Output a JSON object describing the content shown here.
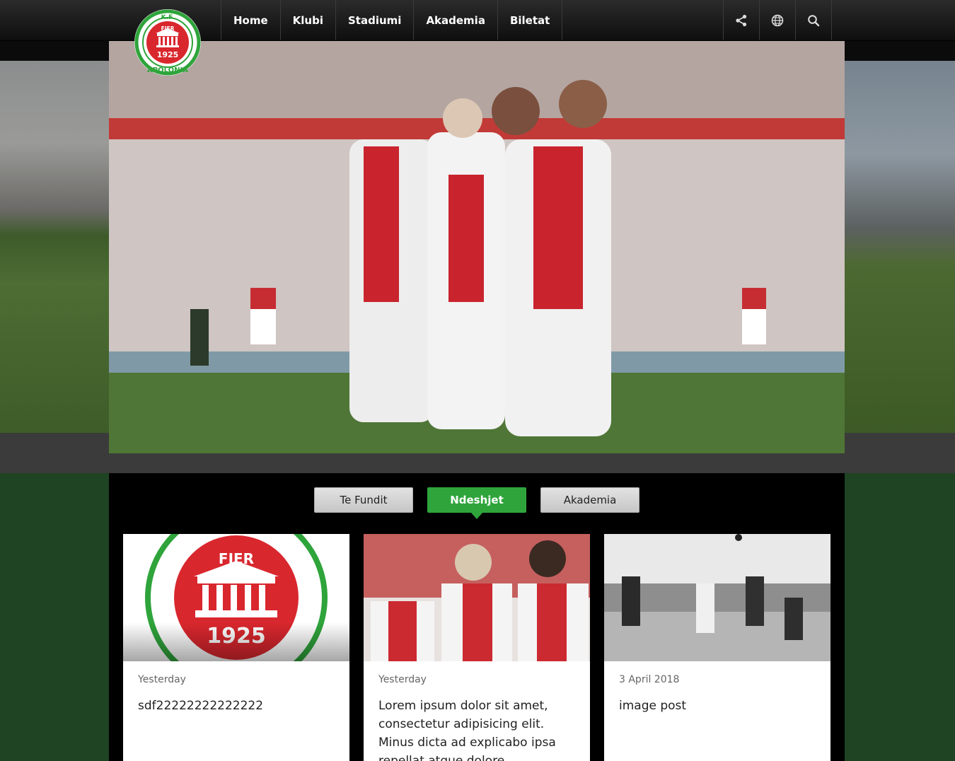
{
  "nav": {
    "items": [
      "Home",
      "Klubi",
      "Stadiumi",
      "Akademia",
      "Biletat"
    ],
    "tools": [
      "share-icon",
      "globe-icon",
      "search-icon"
    ]
  },
  "logo": {
    "top": "K.F.",
    "city": "FIER",
    "year": "1925",
    "name": "APOLONIA"
  },
  "tabs": [
    {
      "label": "Te Fundit",
      "active": false
    },
    {
      "label": "Ndeshjet",
      "active": true
    },
    {
      "label": "Akademia",
      "active": false
    }
  ],
  "cards": [
    {
      "date": "Yesterday",
      "title": "sdf22222222222222"
    },
    {
      "date": "Yesterday",
      "title": "Lorem ipsum dolor sit amet, consectetur adipisicing elit. Minus dicta ad explicabo ipsa repellat atque dolore voluptatibus"
    },
    {
      "date": "3 April 2018",
      "title": "image post"
    }
  ],
  "colors": {
    "accent": "#2fa43b",
    "brand_red": "#d9272e",
    "page_green": "#1f4424"
  }
}
